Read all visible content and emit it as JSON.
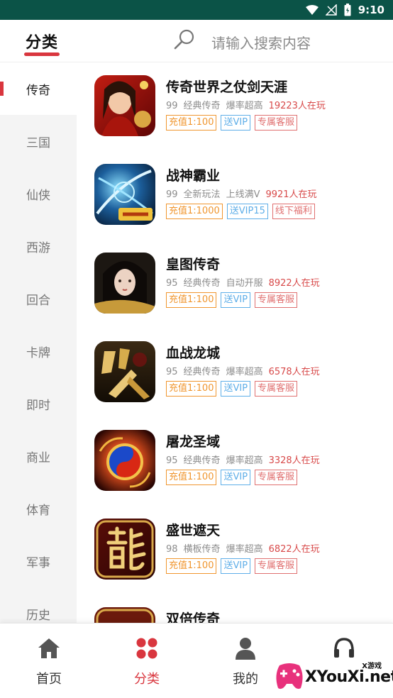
{
  "status": {
    "time": "9:10"
  },
  "header": {
    "title": "分类",
    "search_placeholder": "请输入搜索内容"
  },
  "sidebar": {
    "items": [
      {
        "label": "传奇",
        "active": true
      },
      {
        "label": "三国"
      },
      {
        "label": "仙侠"
      },
      {
        "label": "西游"
      },
      {
        "label": "回合"
      },
      {
        "label": "卡牌"
      },
      {
        "label": "即时"
      },
      {
        "label": "商业"
      },
      {
        "label": "体育"
      },
      {
        "label": "军事"
      },
      {
        "label": "历史"
      }
    ]
  },
  "games": [
    {
      "name": "传奇世界之仗剑天涯",
      "rating": "99",
      "genre": "经典传奇",
      "feature": "爆率超高",
      "players": "19223人在玩",
      "tags": [
        {
          "text": "充值1:100",
          "color": "orange"
        },
        {
          "text": "送VIP",
          "color": "blue"
        },
        {
          "text": "专属客服",
          "color": "red"
        }
      ]
    },
    {
      "name": "战神霸业",
      "rating": "99",
      "genre": "全新玩法",
      "feature": "上线满V",
      "players": "9921人在玩",
      "tags": [
        {
          "text": "充值1:1000",
          "color": "orange"
        },
        {
          "text": "送VIP15",
          "color": "blue"
        },
        {
          "text": "线下福利",
          "color": "red"
        }
      ]
    },
    {
      "name": "皇图传奇",
      "rating": "95",
      "genre": "经典传奇",
      "feature": "自动开服",
      "players": "8922人在玩",
      "tags": [
        {
          "text": "充值1:100",
          "color": "orange"
        },
        {
          "text": "送VIP",
          "color": "blue"
        },
        {
          "text": "专属客服",
          "color": "red"
        }
      ]
    },
    {
      "name": "血战龙城",
      "rating": "95",
      "genre": "经典传奇",
      "feature": "爆率超高",
      "players": "6578人在玩",
      "tags": [
        {
          "text": "充值1:100",
          "color": "orange"
        },
        {
          "text": "送VIP",
          "color": "blue"
        },
        {
          "text": "专属客服",
          "color": "red"
        }
      ]
    },
    {
      "name": "屠龙圣域",
      "rating": "95",
      "genre": "经典传奇",
      "feature": "爆率超高",
      "players": "3328人在玩",
      "tags": [
        {
          "text": "充值1:100",
          "color": "orange"
        },
        {
          "text": "送VIP",
          "color": "blue"
        },
        {
          "text": "专属客服",
          "color": "red"
        }
      ]
    },
    {
      "name": "盛世遮天",
      "rating": "98",
      "genre": "横板传奇",
      "feature": "爆率超高",
      "players": "6822人在玩",
      "tags": [
        {
          "text": "充值1:100",
          "color": "orange"
        },
        {
          "text": "送VIP",
          "color": "blue"
        },
        {
          "text": "专属客服",
          "color": "red"
        }
      ]
    },
    {
      "name": "双倍传奇",
      "rating": "",
      "genre": "",
      "feature": "",
      "players": "",
      "tags": []
    }
  ],
  "bottom_nav": {
    "items": [
      {
        "label": "首页",
        "icon": "home-icon"
      },
      {
        "label": "分类",
        "icon": "category-icon",
        "active": true
      },
      {
        "label": "我的",
        "icon": "user-icon"
      },
      {
        "label": "",
        "icon": "headset-icon"
      }
    ]
  },
  "watermark": {
    "small": "X游戏",
    "big": "XYouXi.net"
  },
  "colors": {
    "accent": "#d9363e",
    "status_bar": "#0b5347",
    "tag_orange": "#f0962f",
    "tag_blue": "#5eaee8",
    "tag_red": "#e07070",
    "players": "#d84a4a"
  }
}
